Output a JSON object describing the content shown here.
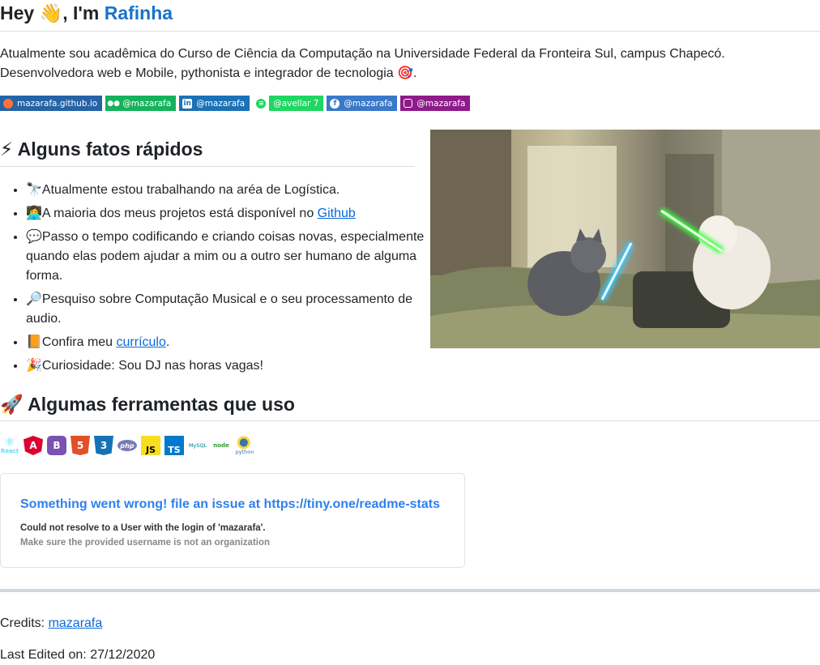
{
  "header": {
    "greeting": "Hey 👋, I'm ",
    "name": "Rafinha"
  },
  "intro": {
    "line1": "Atualmente sou acadêmica do Curso de Ciência da Computação na Universidade Federal da Fronteira Sul, campus Chapecó.",
    "line2": "Desenvolvedora web e Mobile, pythonista e integrador de tecnologia 🎯."
  },
  "badges": [
    {
      "icon": "firefox-icon",
      "label": "mazarafa.github.io"
    },
    {
      "icon": "medium-icon",
      "label": "@mazarafa"
    },
    {
      "icon": "linkedin-icon",
      "label": "@mazarafa"
    },
    {
      "icon": "spotify-icon",
      "label": "@avellar 7"
    },
    {
      "icon": "facebook-icon",
      "label": "@mazarafa"
    },
    {
      "icon": "instagram-icon",
      "label": "@mazarafa"
    }
  ],
  "facts": {
    "title": "⚡ Alguns fatos rápidos",
    "items": [
      {
        "emoji": "🔭",
        "text": "Atualmente estou trabalhando na aréa de Logística."
      },
      {
        "emoji": "👩‍💻",
        "text": "A maioria dos meus projetos está disponível no ",
        "link": "Github"
      },
      {
        "emoji": "💬",
        "text": "Passo o tempo codificando e criando coisas novas, especialmente quando elas podem ajudar a mim ou a outro ser humano de alguma forma."
      },
      {
        "emoji": "🔎",
        "text": "Pesquiso sobre Computação Musical e o seu processamento de audio."
      },
      {
        "emoji": "📙",
        "text": "Confira meu ",
        "link": "currículo",
        "after": "."
      },
      {
        "emoji": "🎉",
        "text": "Curiosidade: Sou DJ nas horas vagas!"
      }
    ]
  },
  "tools": {
    "title": "🚀 Algumas ferramentas que uso",
    "icons": [
      {
        "name": "react-icon",
        "label": "React",
        "color": "#61dafb"
      },
      {
        "name": "angular-icon",
        "label": "A",
        "color": "#dd0031"
      },
      {
        "name": "bootstrap-icon",
        "label": "B",
        "color": "#7952b3"
      },
      {
        "name": "html5-icon",
        "label": "5",
        "color": "#e34f26"
      },
      {
        "name": "css3-icon",
        "label": "3",
        "color": "#1572b6"
      },
      {
        "name": "php-icon",
        "label": "php",
        "color": "#777bb3"
      },
      {
        "name": "javascript-icon",
        "label": "JS",
        "color": "#f7df1e"
      },
      {
        "name": "typescript-icon",
        "label": "TS",
        "color": "#007acc"
      },
      {
        "name": "mysql-icon",
        "label": "MySQL",
        "color": "#00758f"
      },
      {
        "name": "nodejs-icon",
        "label": "node",
        "color": "#339933"
      },
      {
        "name": "python-icon",
        "label": "python",
        "color": "#3776ab"
      }
    ]
  },
  "stats_card": {
    "error_title": "Something went wrong! file an issue at https://tiny.one/readme-stats",
    "error_detail": "Could not resolve to a User with the login of 'mazarafa'.",
    "error_hint": "Make sure the provided username is not an organization"
  },
  "footer": {
    "credits_label": "Credits: ",
    "credits_link": "mazarafa",
    "edited": "Last Edited on: 27/12/2020"
  }
}
